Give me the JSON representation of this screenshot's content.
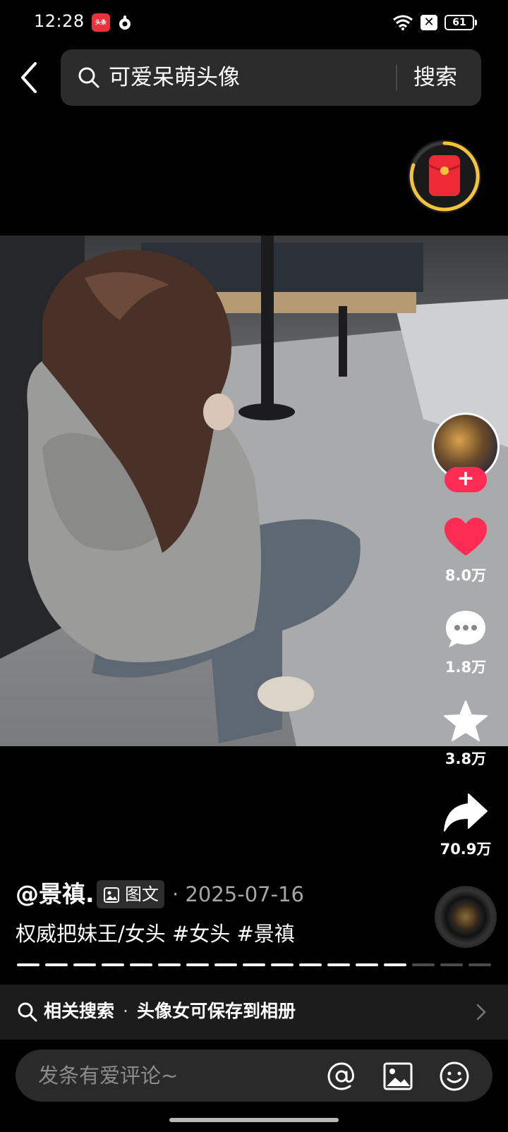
{
  "status_bar": {
    "time": "12:28",
    "app_badge": "头条",
    "battery": "61",
    "sim_label": "✕"
  },
  "search": {
    "query": "可爱呆萌头像",
    "submit_label": "搜索"
  },
  "actions": {
    "likes": "8.0万",
    "comments": "1.8万",
    "favorites": "3.8万",
    "shares": "70.9万",
    "follow_label": "+"
  },
  "post": {
    "author": "@景禛.",
    "type_badge": "图文",
    "date": "· 2025-07-16",
    "caption": "权威把妹王/女头 #女头 #景禛"
  },
  "carousel": {
    "total_images": 17,
    "viewed_images": 14
  },
  "related_search": {
    "label": "相关搜索",
    "separator": "·",
    "text": "头像女可保存到相册"
  },
  "comment_input": {
    "placeholder": "发条有爱评论~"
  },
  "icons": {
    "back": "chevron-left-icon",
    "search": "search-icon",
    "like": "heart-icon",
    "comment": "comment-bubble-icon",
    "favorite": "star-icon",
    "share": "share-arrow-icon",
    "at": "at-icon",
    "image": "image-icon",
    "emoji": "emoji-icon"
  },
  "colors": {
    "like": "#fe2c55",
    "follow": "#fe2c55",
    "timer_ring": "#f5c33b",
    "background": "#000000"
  }
}
